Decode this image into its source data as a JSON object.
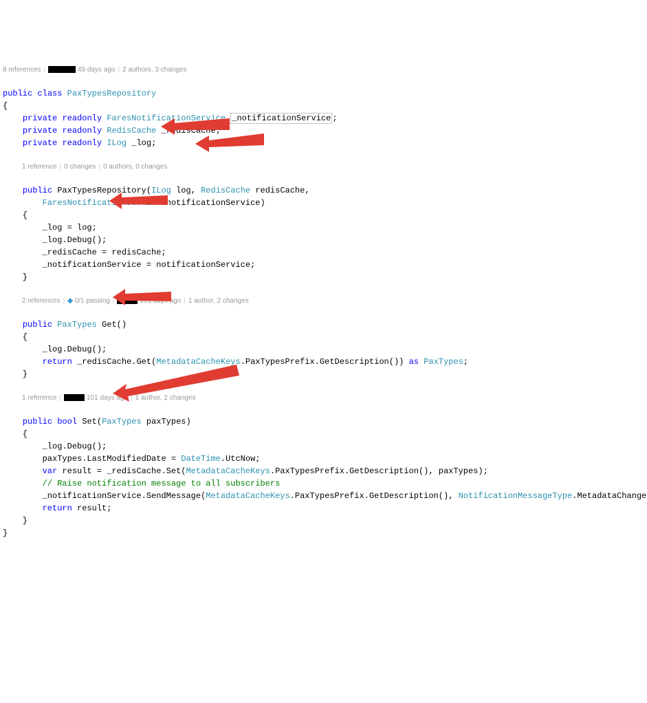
{
  "codelens": {
    "class": {
      "refs": "8 references",
      "days": "49 days ago",
      "authors": "2 authors, 3 changes"
    },
    "ctor": {
      "refs": "1 reference",
      "changes": "0 changes",
      "authors": "0 authors, 0 changes"
    },
    "get": {
      "refs": "2 references",
      "pass": "0/1 passing",
      "days": "101 days ago",
      "authors": "1 author, 2 changes"
    },
    "set": {
      "refs": "1 reference",
      "days": "101 days ago",
      "authors": "1 author, 2 changes"
    }
  },
  "kw": {
    "public": "public",
    "class": "class",
    "private": "private",
    "readonly": "readonly",
    "return": "return",
    "as": "as",
    "bool": "bool",
    "var": "var"
  },
  "types": {
    "PaxTypesRepository": "PaxTypesRepository",
    "FaresNotificationService": "FaresNotificationService",
    "RedisCache": "RedisCache",
    "ILog": "ILog",
    "PaxTypes": "PaxTypes",
    "MetadataCacheKeys": "MetadataCacheKeys",
    "DateTime": "DateTime",
    "NotificationMessageType": "NotificationMessageType"
  },
  "ids": {
    "notificationService": "_notificationService",
    "redisCache": "_redisCache",
    "log": "_log",
    "ctorName": "PaxTypesRepository",
    "pLog": "log",
    "pRedisCache": "redisCache",
    "pNotificationService": "notificationService",
    "Get": "Get",
    "Set": "Set",
    "paxTypes": "paxTypes",
    "Debug": "Debug",
    "GetMethod": "Get",
    "SetMethod": "Set",
    "PaxTypesPrefix": "PaxTypesPrefix",
    "GetDescription": "GetDescription",
    "LastModifiedDate": "LastModifiedDate",
    "UtcNow": "UtcNow",
    "result": "result",
    "SendMessage": "SendMessage",
    "MetadataChanged": "MetadataChanged"
  },
  "comments": {
    "raise": "// Raise notification message to all subscribers"
  }
}
